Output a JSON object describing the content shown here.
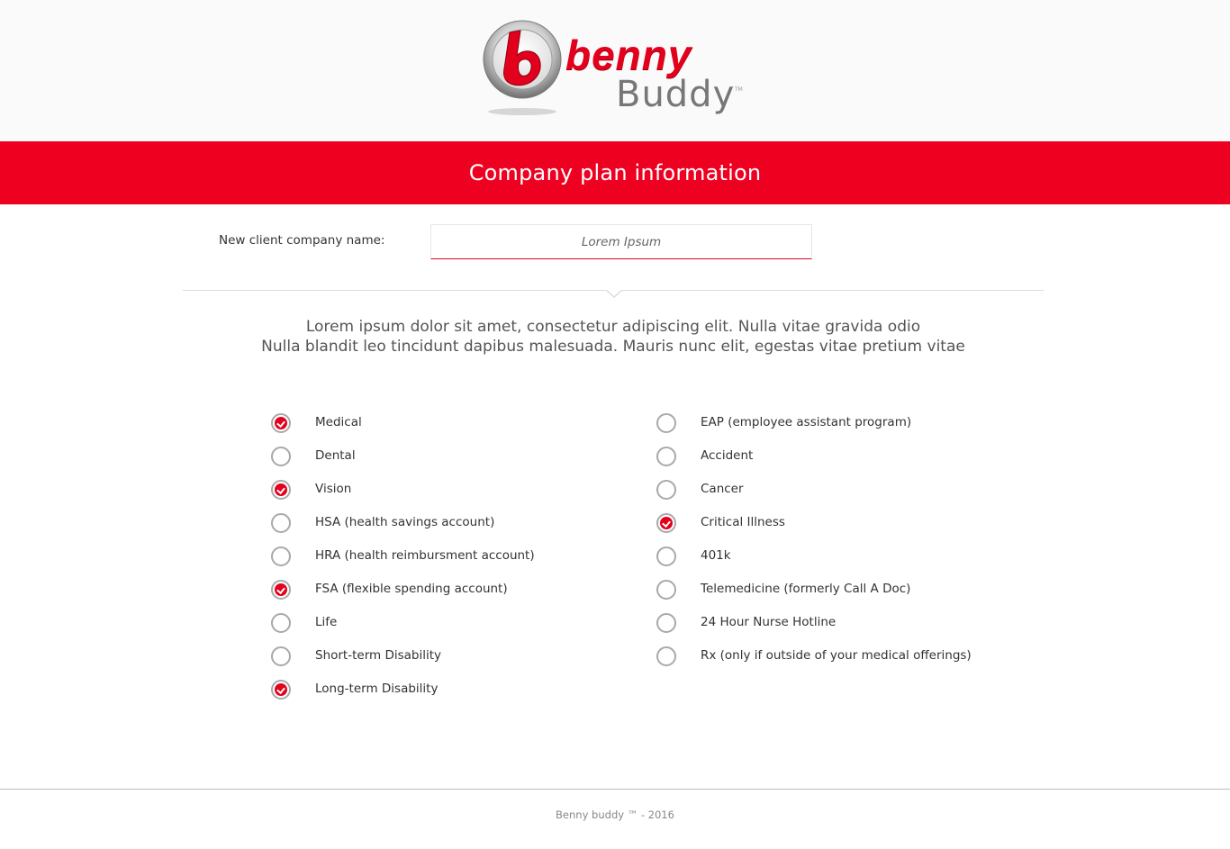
{
  "brand": {
    "name_part1": "benny",
    "name_part2": "Buddy",
    "trademark": "TM",
    "accent_color": "#ee0021"
  },
  "header": {
    "title": "Company plan information"
  },
  "form": {
    "company_label": "New client company name:",
    "company_placeholder": "Lorem Ipsum"
  },
  "intro": {
    "line1": "Lorem ipsum dolor sit amet, consectetur adipiscing elit. Nulla vitae gravida odio",
    "line2": "Nulla blandit leo tincidunt dapibus malesuada. Mauris nunc elit, egestas vitae pretium vitae"
  },
  "options_left": [
    {
      "label": "Medical",
      "checked": true
    },
    {
      "label": "Dental",
      "checked": false
    },
    {
      "label": "Vision",
      "checked": true
    },
    {
      "label": "HSA (health savings account)",
      "checked": false
    },
    {
      "label": "HRA (health reimbursment account)",
      "checked": false
    },
    {
      "label": "FSA (flexible spending account)",
      "checked": true
    },
    {
      "label": "Life",
      "checked": false
    },
    {
      "label": "Short-term Disability",
      "checked": false
    },
    {
      "label": "Long-term Disability",
      "checked": true
    }
  ],
  "options_right": [
    {
      "label": "EAP (employee assistant program)",
      "checked": false
    },
    {
      "label": "Accident",
      "checked": false
    },
    {
      "label": "Cancer",
      "checked": false
    },
    {
      "label": "Critical Illness",
      "checked": true
    },
    {
      "label": "401k",
      "checked": false
    },
    {
      "label": "Telemedicine (formerly Call A Doc)",
      "checked": false
    },
    {
      "label": "24 Hour Nurse Hotline",
      "checked": false
    },
    {
      "label": "Rx (only if outside of your medical offerings)",
      "checked": false
    }
  ],
  "footer": {
    "text": "Benny buddy ™ - 2016"
  }
}
